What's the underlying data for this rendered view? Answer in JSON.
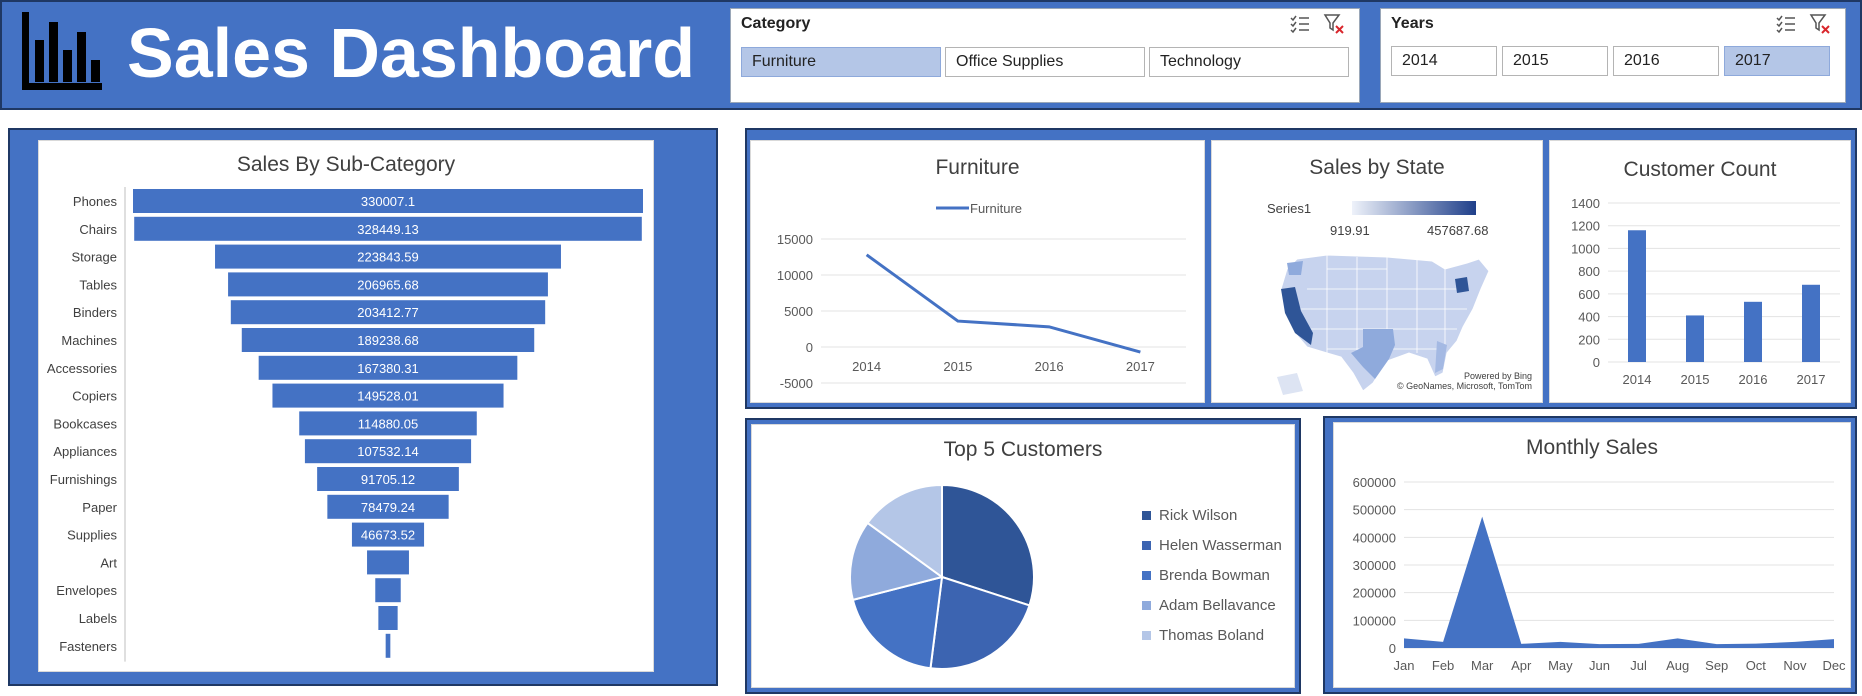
{
  "header": {
    "title": "Sales Dashboard"
  },
  "slicers": {
    "category": {
      "title": "Category",
      "options": [
        "Furniture",
        "Office Supplies",
        "Technology"
      ],
      "selected": "Furniture"
    },
    "years": {
      "title": "Years",
      "options": [
        "2014",
        "2015",
        "2016",
        "2017"
      ],
      "selected": "2017"
    }
  },
  "colors": {
    "banner": "#4472c4",
    "border": "#1f3864",
    "bar": "#4472c4",
    "slicer_selected": "#b4c6e7"
  },
  "charts": {
    "subcategory": {
      "title": "Sales By Sub-Category",
      "chart_data": {
        "type": "bar",
        "categories": [
          "Phones",
          "Chairs",
          "Storage",
          "Tables",
          "Binders",
          "Machines",
          "Accessories",
          "Copiers",
          "Bookcases",
          "Appliances",
          "Furnishings",
          "Paper",
          "Supplies",
          "Art",
          "Envelopes",
          "Labels",
          "Fasteners"
        ],
        "values": [
          330007.1,
          328449.13,
          223843.59,
          206965.68,
          203412.77,
          189238.68,
          167380.31,
          149528.01,
          114880.05,
          107532.14,
          91705.12,
          78479.24,
          46673.52,
          27118.79,
          16476.4,
          12486.31,
          3024.28
        ],
        "labels": [
          "330007.1",
          "328449.13",
          "223843.59",
          "206965.68",
          "203412.77",
          "189238.68",
          "167380.31",
          "149528.01",
          "114880.05",
          "107532.14",
          "91705.12",
          "78479.24",
          "46673.52",
          "",
          "",
          "",
          ""
        ]
      }
    },
    "furniture": {
      "title": "Furniture",
      "chart_data": {
        "type": "line",
        "categories": [
          "2014",
          "2015",
          "2016",
          "2017"
        ],
        "series": [
          {
            "name": "Furniture",
            "values": [
              12800,
              3600,
              2800,
              -700
            ]
          }
        ],
        "yticks": [
          "15000",
          "10000",
          "5000",
          "0",
          "-5000"
        ],
        "ylim": [
          -5000,
          15000
        ]
      }
    },
    "state": {
      "title": "Sales by State",
      "legend": {
        "series": "Series1",
        "min": "919.91",
        "max": "457687.68"
      },
      "credit_1": "Powered by Bing",
      "credit_2": "© GeoNames, Microsoft, TomTom"
    },
    "customers": {
      "title": "Customer Count",
      "chart_data": {
        "type": "bar",
        "categories": [
          "2014",
          "2015",
          "2016",
          "2017"
        ],
        "values": [
          1160,
          410,
          530,
          680
        ],
        "yticks": [
          "1400",
          "1200",
          "1000",
          "800",
          "600",
          "400",
          "200",
          "0"
        ],
        "ylim": [
          0,
          1400
        ]
      }
    },
    "top5": {
      "title": "Top 5 Customers",
      "chart_data": {
        "type": "pie",
        "series": [
          {
            "name": "Top 5 Customers",
            "values": [
              30,
              22,
              19,
              14,
              15
            ]
          }
        ],
        "labels": [
          "Rick Wilson",
          "Helen Wasserman",
          "Brenda Bowman",
          "Adam Bellavance",
          "Thomas Boland"
        ],
        "colors": [
          "#2f5597",
          "#3c64b1",
          "#4472c4",
          "#8faadc",
          "#b4c6e7"
        ]
      }
    },
    "monthly": {
      "title": "Monthly Sales",
      "chart_data": {
        "type": "area",
        "categories": [
          "Jan",
          "Feb",
          "Mar",
          "Apr",
          "May",
          "Jun",
          "Jul",
          "Aug",
          "Sep",
          "Oct",
          "Nov",
          "Dec"
        ],
        "values": [
          35000,
          22000,
          475000,
          15000,
          22000,
          14000,
          15000,
          35000,
          14000,
          16000,
          22000,
          32000
        ],
        "yticks": [
          "600000",
          "500000",
          "400000",
          "300000",
          "200000",
          "100000",
          "0"
        ],
        "ylim": [
          0,
          600000
        ]
      }
    }
  }
}
